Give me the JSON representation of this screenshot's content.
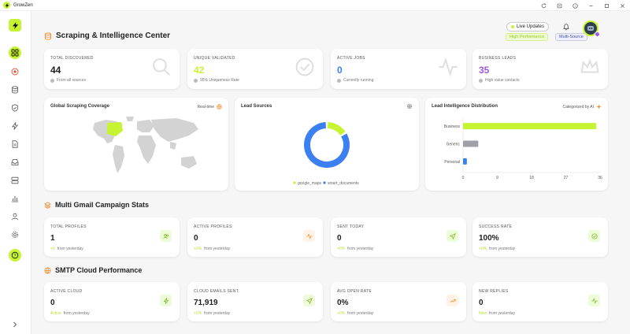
{
  "app": {
    "title": "GrowZen"
  },
  "header": {
    "title": "Scraping & Intelligence Center",
    "live_label": "Live Updates",
    "badge_performance": "High Performance",
    "badge_source": "Multi-Source"
  },
  "stats": [
    {
      "label": "TOTAL DISCOVERED",
      "value": "44",
      "sub": "From all sources",
      "color": "#1e1e1e"
    },
    {
      "label": "UNIQUE VALIDATED",
      "value": "42",
      "sub": "95% Uniqueness Rate",
      "color": "#c6f432"
    },
    {
      "label": "ACTIVE JOBS",
      "value": "0",
      "sub": "Currently running",
      "color": "#3b7ff0"
    },
    {
      "label": "BUSINESS LEADS",
      "value": "35",
      "sub": "High value contacts",
      "color": "#9b59e6"
    }
  ],
  "panels": {
    "coverage": {
      "title": "Global Scraping Coverage",
      "side": "Real-time"
    },
    "sources": {
      "title": "Lead Sources"
    },
    "distribution": {
      "title": "Lead Intelligence Distribution",
      "side": "Categorized by AI"
    }
  },
  "chart_data": [
    {
      "type": "pie",
      "title": "Lead Sources",
      "labels": [
        "google_maps",
        "smart_documents"
      ],
      "values": [
        7,
        37
      ],
      "colors": [
        "#c6f432",
        "#3b7ff0"
      ]
    },
    {
      "type": "bar",
      "orientation": "horizontal",
      "title": "Lead Intelligence Distribution",
      "categories": [
        "Business",
        "Generic",
        "Personal"
      ],
      "values": [
        35,
        4,
        1
      ],
      "colors": [
        "#c6f432",
        "#a0a0a8",
        "#3b7ff0"
      ],
      "xticks": [
        "0",
        "9",
        "18",
        "27",
        "36"
      ],
      "xlim": [
        0,
        36
      ]
    }
  ],
  "gmail": {
    "title": "Multi Gmail Campaign Stats",
    "cards": [
      {
        "label": "TOTAL PROFILES",
        "value": "1",
        "pct": "+0",
        "sub": "from yesterday",
        "icon_bg": "#eefbd8",
        "icon_color": "#7fb21a"
      },
      {
        "label": "ACTIVE PROFILES",
        "value": "0",
        "pct": "+0%",
        "sub": "from yesterday",
        "icon_bg": "#fff2e6",
        "icon_color": "#f08a2c"
      },
      {
        "label": "SENT TODAY",
        "value": "0",
        "pct": "+0%",
        "sub": "from yesterday",
        "icon_bg": "#eefbd8",
        "icon_color": "#7fb21a"
      },
      {
        "label": "SUCCESS RATE",
        "value": "100%",
        "pct": "+0%",
        "sub": "from yesterday",
        "icon_bg": "#eefbd8",
        "icon_color": "#7fb21a"
      }
    ]
  },
  "smtp": {
    "title": "SMTP Cloud Performance",
    "cards": [
      {
        "label": "ACTIVE CLOUD",
        "value": "0",
        "pct": "Active",
        "sub": "from yesterday",
        "icon_bg": "#eefbd8",
        "icon_color": "#7fb21a"
      },
      {
        "label": "CLOUD EMAILS SENT",
        "value": "71,919",
        "pct": "+0%",
        "sub": "from yesterday",
        "icon_bg": "#eefbd8",
        "icon_color": "#7fb21a"
      },
      {
        "label": "AVG OPEN RATE",
        "value": "0%",
        "pct": "+0%",
        "sub": "from yesterday",
        "icon_bg": "#fff2e6",
        "icon_color": "#f08a2c"
      },
      {
        "label": "NEW REPLIES",
        "value": "0",
        "pct": "New",
        "sub": "from yesterday",
        "icon_bg": "#eefbd8",
        "icon_color": "#7fb21a"
      }
    ]
  }
}
